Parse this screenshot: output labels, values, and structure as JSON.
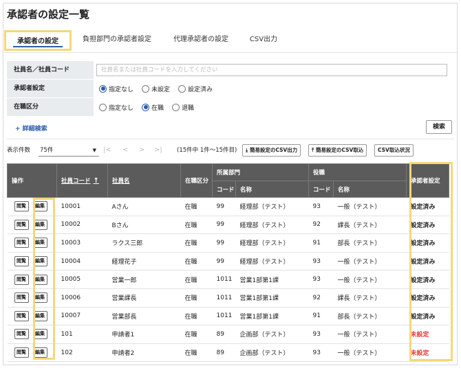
{
  "page": {
    "title": "承認者の設定一覧"
  },
  "tabs": [
    {
      "label": "承認者の設定",
      "active": true
    },
    {
      "label": "負担部門の承認者設定",
      "active": false
    },
    {
      "label": "代理承認者の設定",
      "active": false
    },
    {
      "label": "CSV出力",
      "active": false
    }
  ],
  "form": {
    "employee": {
      "label": "社員名／社員コード",
      "placeholder": "社員名または社員コードを入力してください",
      "value": ""
    },
    "approver": {
      "label": "承認者設定",
      "options": [
        "指定なし",
        "未設定",
        "設定済み"
      ],
      "selected": "指定なし"
    },
    "employment": {
      "label": "在職区分",
      "options": [
        "指定なし",
        "在職",
        "退職"
      ],
      "selected": "在職"
    }
  },
  "advanced_search": "+ 詳細検索",
  "search_button": "検索",
  "toolbar": {
    "count_label": "表示件数",
    "count_value": "75件",
    "range_text": "(15件中 1件～15件目)",
    "export_csv": "簡易設定のCSV出力",
    "import_csv": "簡易設定のCSV取込",
    "import_status": "CSV取込状況"
  },
  "table": {
    "headers": {
      "ops": "操作",
      "emp_code": "社員コード",
      "emp_name": "社員名",
      "employment": "在職区分",
      "dept": "所属部門",
      "position": "役職",
      "code": "コード",
      "name": "名称",
      "approver": "承認者設定"
    },
    "view_label": "閲覧",
    "edit_label": "編集",
    "rows": [
      {
        "code": "10001",
        "name": "Aさん",
        "status": "在職",
        "dept_code": "99",
        "dept_name": "経理部（テスト）",
        "pos_code": "93",
        "pos_name": "一般（テスト）",
        "approver": "設定済み"
      },
      {
        "code": "10002",
        "name": "Bさん",
        "status": "在職",
        "dept_code": "99",
        "dept_name": "経理部（テスト）",
        "pos_code": "92",
        "pos_name": "課長（テスト）",
        "approver": "設定済み"
      },
      {
        "code": "10003",
        "name": "ラクス三郎",
        "status": "在職",
        "dept_code": "99",
        "dept_name": "経理部（テスト）",
        "pos_code": "91",
        "pos_name": "部長（テスト）",
        "approver": "設定済み"
      },
      {
        "code": "10004",
        "name": "経理花子",
        "status": "在職",
        "dept_code": "99",
        "dept_name": "経理部（テスト）",
        "pos_code": "93",
        "pos_name": "一般（テスト）",
        "approver": "設定済み"
      },
      {
        "code": "10005",
        "name": "営業一郎",
        "status": "在職",
        "dept_code": "1011",
        "dept_name": "営業1部第1課",
        "pos_code": "93",
        "pos_name": "一般（テスト）",
        "approver": "設定済み"
      },
      {
        "code": "10006",
        "name": "営業課長",
        "status": "在職",
        "dept_code": "1011",
        "dept_name": "営業1部第1課",
        "pos_code": "92",
        "pos_name": "課長（テスト）",
        "approver": "設定済み"
      },
      {
        "code": "10007",
        "name": "営業部長",
        "status": "在職",
        "dept_code": "1011",
        "dept_name": "営業1部第1課",
        "pos_code": "91",
        "pos_name": "部長（テスト）",
        "approver": "設定済み"
      },
      {
        "code": "101",
        "name": "申請者1",
        "status": "在職",
        "dept_code": "89",
        "dept_name": "企画部（テスト）",
        "pos_code": "93",
        "pos_name": "一般（テスト）",
        "approver": "未設定"
      },
      {
        "code": "102",
        "name": "申請者2",
        "status": "在職",
        "dept_code": "89",
        "dept_name": "企画部（テスト）",
        "pos_code": "93",
        "pos_name": "一般（テスト）",
        "approver": "未設定"
      }
    ]
  },
  "colors": {
    "accent": "#2a5caa",
    "highlight": "#f5d77a",
    "header_bg": "#5b5b5b",
    "unset": "#e23b3b"
  }
}
